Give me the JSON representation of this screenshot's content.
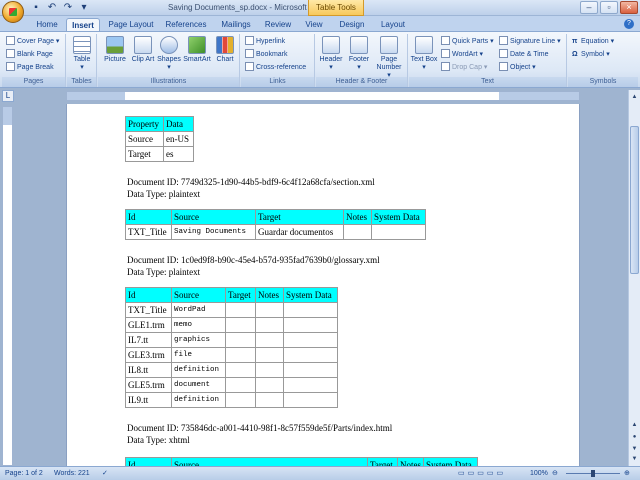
{
  "window": {
    "title": "Saving Documents_sp.docx - Microsoft Word",
    "context_tab": "Table Tools"
  },
  "tabs": [
    "Home",
    "Insert",
    "Page Layout",
    "References",
    "Mailings",
    "Review",
    "View",
    "Design",
    "Layout"
  ],
  "active_tab": "Insert",
  "ribbon": {
    "pages": {
      "items": [
        "Cover Page",
        "Blank Page",
        "Page Break"
      ],
      "label": "Pages"
    },
    "tables": {
      "items": [
        "Table"
      ],
      "label": "Tables"
    },
    "illustrations": {
      "items": [
        "Picture",
        "Clip Art",
        "Shapes",
        "SmartArt",
        "Chart"
      ],
      "label": "Illustrations"
    },
    "links": {
      "items": [
        "Hyperlink",
        "Bookmark",
        "Cross-reference"
      ],
      "label": "Links"
    },
    "header_footer": {
      "items": [
        "Header",
        "Footer",
        "Page Number"
      ],
      "label": "Header & Footer"
    },
    "text": {
      "textbox": "Text Box",
      "items": [
        "Quick Parts",
        "WordArt",
        "Drop Cap",
        "Signature Line",
        "Date & Time",
        "Object"
      ],
      "label": "Text"
    },
    "symbols": {
      "items": [
        "Equation",
        "Symbol"
      ],
      "label": "Symbols"
    }
  },
  "document": {
    "table1": {
      "header": [
        "Property",
        "Data"
      ],
      "rows": [
        [
          "Source",
          "en-US"
        ],
        [
          "Target",
          "es"
        ]
      ]
    },
    "block1": {
      "id": "Document ID: 7749d325-1d90-44b5-bdf9-6c4f12a68cfa/section.xml",
      "type": "Data Type: plaintext"
    },
    "table2": {
      "header": [
        "Id",
        "Source",
        "Target",
        "Notes",
        "System Data"
      ],
      "rows": [
        [
          "TXT_Title",
          "Saving Documents",
          "Guardar documentos",
          "",
          ""
        ]
      ]
    },
    "block2": {
      "id": "Document ID: 1c0ed9f8-b90c-45e4-b57d-935fad7639b0/glossary.xml",
      "type": "Data Type: plaintext"
    },
    "table3": {
      "header": [
        "Id",
        "Source",
        "Target",
        "Notes",
        "System Data"
      ],
      "rows": [
        [
          "TXT_Title",
          "WordPad",
          "",
          "",
          ""
        ],
        [
          "GLE1.trm",
          "memo",
          "",
          "",
          ""
        ],
        [
          "IL7.tt",
          "graphics",
          "",
          "",
          ""
        ],
        [
          "GLE3.trm",
          "file",
          "",
          "",
          ""
        ],
        [
          "IL8.tt",
          "definition",
          "",
          "",
          ""
        ],
        [
          "GLE5.trm",
          "document",
          "",
          "",
          ""
        ],
        [
          "IL9.tt",
          "definition",
          "",
          "",
          ""
        ]
      ]
    },
    "block3": {
      "id": "Document ID: 735846dc-a001-4410-98f1-8c57f559de5f/Parts/index.html",
      "type": "Data Type: xhtml"
    },
    "table4": {
      "header": [
        "Id",
        "Source",
        "Target",
        "Notes",
        "System Data"
      ]
    }
  },
  "status": {
    "page": "Page: 1 of 2",
    "words": "Words: 221",
    "zoom": "100%"
  }
}
